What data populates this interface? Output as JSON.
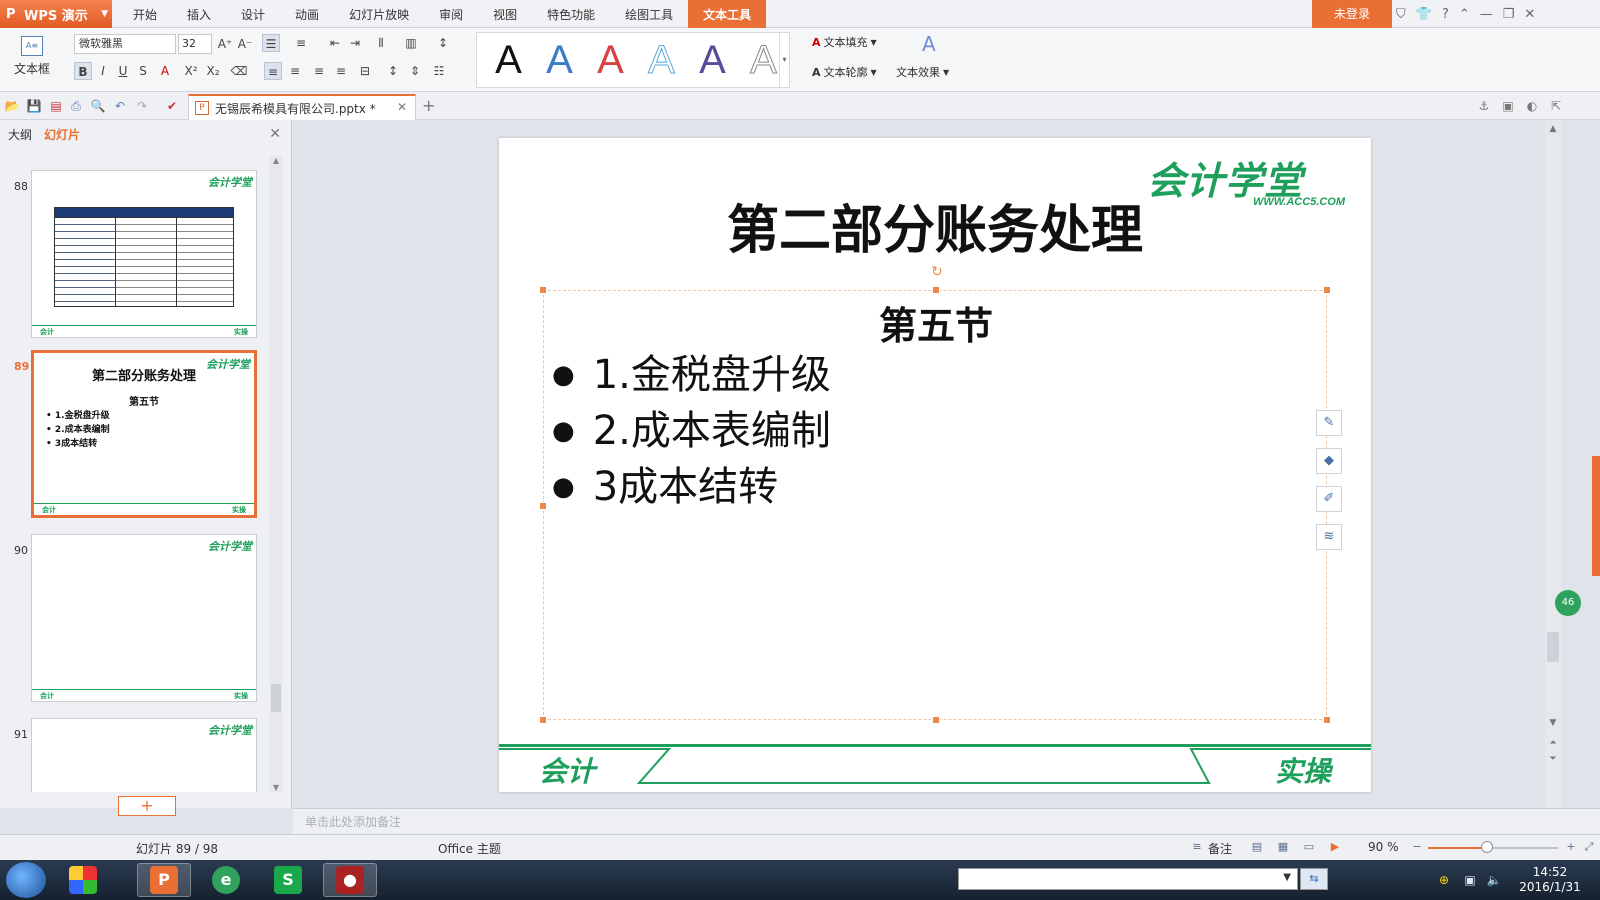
{
  "app": {
    "name": "WPS 演示",
    "login_label": "未登录",
    "accent": "#e96f35",
    "brand_green": "#1e9f5c"
  },
  "menu": {
    "tabs": [
      "开始",
      "插入",
      "设计",
      "动画",
      "幻灯片放映",
      "审阅",
      "视图",
      "特色功能",
      "绘图工具",
      "文本工具"
    ],
    "active_tab": "文本工具"
  },
  "ribbon": {
    "textbox_label": "文本框",
    "font_name": "微软雅黑",
    "font_size": "32",
    "wordart_glyph": "A",
    "wordart_colors": [
      "#111111",
      "#3d7ac7",
      "#d94040",
      "#8fd0ef",
      "#5a4a9c",
      "#888888"
    ],
    "text_fill_label": "文本填充",
    "text_outline_label": "文本轮廓",
    "text_effect_label": "文本效果"
  },
  "document": {
    "tab_name": "无锡辰希模具有限公司.pptx *"
  },
  "left_panel": {
    "tab_outline": "大纲",
    "tab_slides": "幻灯片",
    "thumbnails": [
      {
        "num": "88",
        "logo": "会计学堂",
        "footer_left": "会计",
        "footer_right": "实操"
      },
      {
        "num": "89",
        "logo": "会计学堂",
        "title": "第二部分账务处理",
        "subtitle": "第五节",
        "bullets": [
          "1.金税盘升级",
          "2.成本表编制",
          "3成本结转"
        ],
        "footer_left": "会计",
        "footer_right": "实操"
      },
      {
        "num": "90",
        "logo": "会计学堂",
        "footer_left": "会计",
        "footer_right": "实操"
      },
      {
        "num": "91",
        "logo": "会计学堂"
      }
    ],
    "add_slide_label": "+"
  },
  "slide": {
    "logo": "会计学堂",
    "logo_url": "WWW.ACC5.COM",
    "title": "第二部分账务处理",
    "subtitle": "第五节",
    "bullets": [
      "1.金税盘升级",
      "2.成本表编制",
      "3成本结转"
    ],
    "footer_left": "会计",
    "footer_right": "实操"
  },
  "notes": {
    "placeholder": "单击此处添加备注"
  },
  "status": {
    "slide_counter": "幻灯片 89 / 98",
    "theme": "Office 主题",
    "notes_label": "备注",
    "zoom": "90 %",
    "zoom_fraction": 0.45
  },
  "taskbar": {
    "time": "14:52",
    "date": "2016/1/31",
    "badge": "46"
  }
}
